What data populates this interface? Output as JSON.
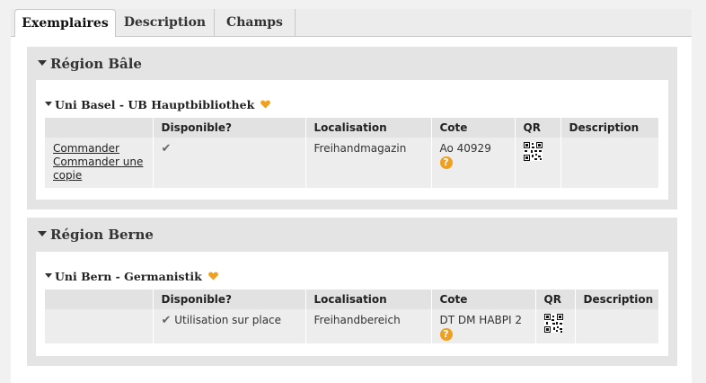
{
  "tabs": [
    {
      "label": "Exemplaires",
      "active": true
    },
    {
      "label": "Description",
      "active": false
    },
    {
      "label": "Champs",
      "active": false
    }
  ],
  "regions": [
    {
      "title": "Région Bâle",
      "library": {
        "name": "Uni Basel - UB Hauptbibliothek",
        "columns": [
          "",
          "Disponible?",
          "Localisation",
          "Cote",
          "QR",
          "Description"
        ],
        "rows": [
          {
            "actions": [
              "Commander",
              "Commander une copie"
            ],
            "available_icon": "checkmark-icon",
            "available_text": "",
            "location": "Freihandmagazin",
            "cote": "Ao 40929",
            "description": ""
          }
        ]
      }
    },
    {
      "title": "Région Berne",
      "library": {
        "name": "Uni Bern - Germanistik",
        "columns": [
          "",
          "Disponible?",
          "Localisation",
          "Cote",
          "QR",
          "Description"
        ],
        "rows": [
          {
            "actions": [],
            "available_icon": "checkmark-icon",
            "available_text": "Utilisation sur place",
            "location": "Freihandbereich",
            "cote": "DT DM HABPI 2",
            "description": ""
          }
        ]
      }
    }
  ],
  "icons": {
    "help": "?",
    "check": "✔"
  },
  "colors": {
    "accent": "#f0a020",
    "region_bg": "#e4e4e4",
    "header_bg": "#e2e2e2"
  }
}
